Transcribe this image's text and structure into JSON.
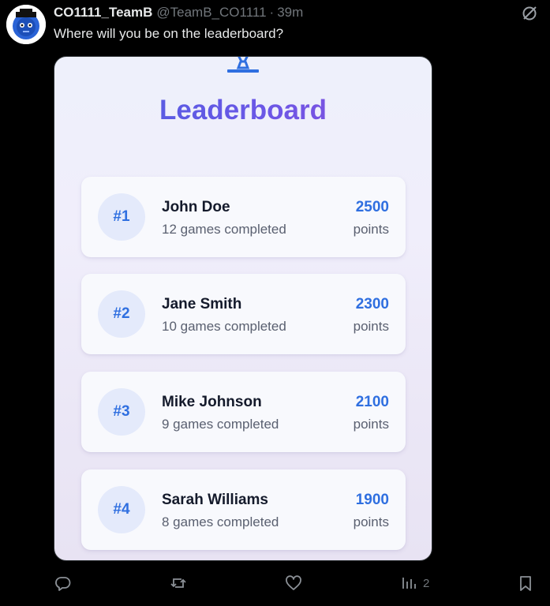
{
  "post": {
    "display_name": "CO1111_TeamB",
    "handle": "@TeamB_CO1111",
    "separator": "·",
    "time": "39m",
    "text": "Where will you be on the leaderboard?"
  },
  "icons": {
    "grok": "grok-icon",
    "reply": "reply-icon",
    "repost": "repost-icon",
    "like": "like-icon",
    "views": "views-icon",
    "bookmark": "bookmark-icon"
  },
  "media": {
    "title": "Leaderboard",
    "entries": [
      {
        "rank": "#1",
        "name": "John Doe",
        "games": "12 games completed",
        "score": "2500",
        "points_label": "points"
      },
      {
        "rank": "#2",
        "name": "Jane Smith",
        "games": "10 games completed",
        "score": "2300",
        "points_label": "points"
      },
      {
        "rank": "#3",
        "name": "Mike Johnson",
        "games": "9 games completed",
        "score": "2100",
        "points_label": "points"
      },
      {
        "rank": "#4",
        "name": "Sarah Williams",
        "games": "8 games completed",
        "score": "1900",
        "points_label": "points"
      }
    ]
  },
  "actions": {
    "views_count": "2"
  },
  "colors": {
    "background": "#000000",
    "accent_blue": "#2f6fe0",
    "title_gradient_start": "#4a5fe0",
    "title_gradient_end": "#8e4fdc",
    "muted_text": "#71767b"
  }
}
